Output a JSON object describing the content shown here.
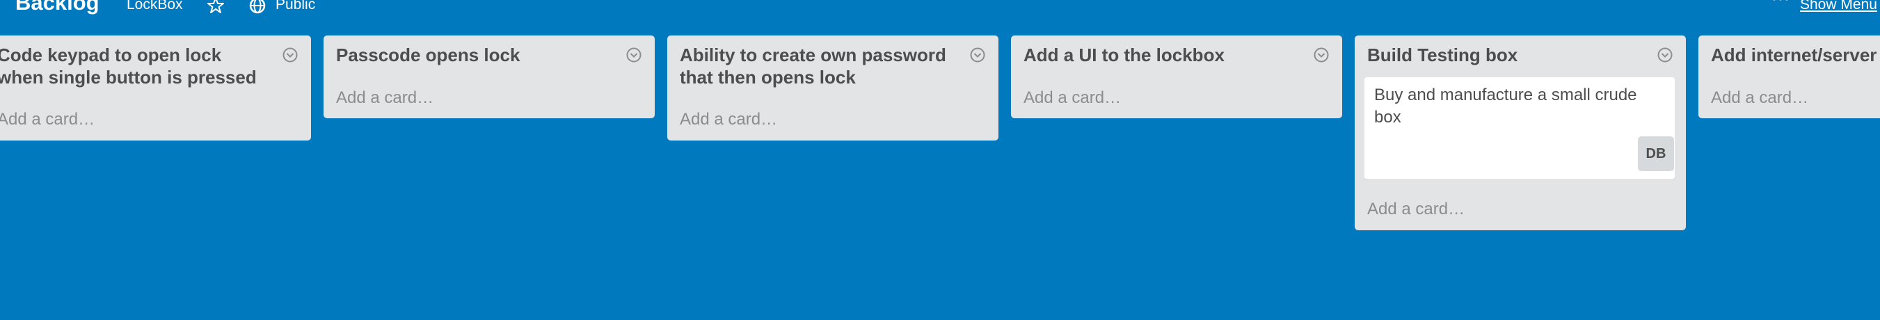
{
  "header": {
    "board_title": "Backlog",
    "org_link": "LockBox",
    "star_icon": "star-icon",
    "visibility_icon": "globe-icon",
    "visibility_label": "Public",
    "menu_icon": "ellipsis-icon",
    "show_menu_label": "Show Menu"
  },
  "lists": [
    {
      "title_lines": [
        "Code keypad to open lock",
        "when single button is pressed"
      ],
      "add_card_label": "Add a card…",
      "cards": []
    },
    {
      "title_lines": [
        "Passcode opens lock"
      ],
      "add_card_label": "Add a card…",
      "cards": []
    },
    {
      "title_lines": [
        "Ability to create own password",
        "that then opens lock"
      ],
      "add_card_label": "Add a card…",
      "cards": []
    },
    {
      "title_lines": [
        "Add a UI to the lockbox"
      ],
      "add_card_label": "Add a card…",
      "cards": []
    },
    {
      "title_lines": [
        "Build Testing box"
      ],
      "add_card_label": "Add a card…",
      "cards": [
        {
          "text_lines": [
            "Buy and manufacture a small crude",
            "box"
          ],
          "member_initials": "DB"
        }
      ]
    },
    {
      "title_lines": [
        "Add internet/server"
      ],
      "add_card_label": "Add a card…",
      "cards": []
    }
  ],
  "colors": {
    "board_background": "#0079bf",
    "list_background": "#e2e4e6",
    "card_background": "#ffffff",
    "title_text": "#4d4d4d",
    "muted_text": "#8c8c8c"
  }
}
